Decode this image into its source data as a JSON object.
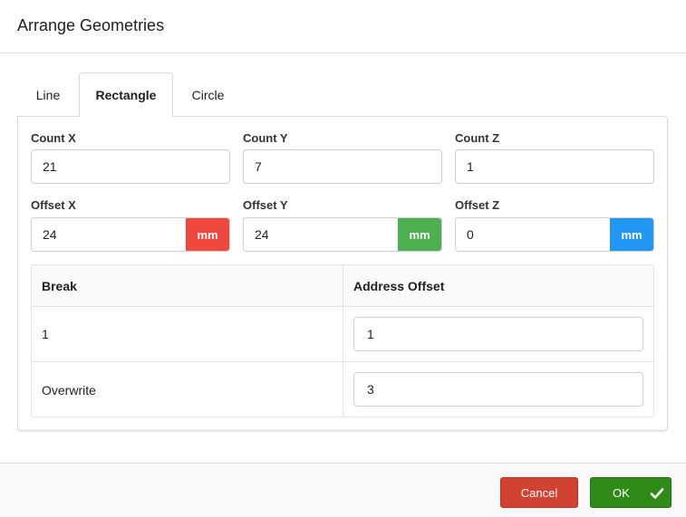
{
  "dialog": {
    "title": "Arrange Geometries"
  },
  "tabs": [
    {
      "label": "Line",
      "active": false
    },
    {
      "label": "Rectangle",
      "active": true
    },
    {
      "label": "Circle",
      "active": false
    }
  ],
  "fields": {
    "count_x": {
      "label": "Count X",
      "value": "21"
    },
    "count_y": {
      "label": "Count Y",
      "value": "7"
    },
    "count_z": {
      "label": "Count Z",
      "value": "1"
    },
    "offset_x": {
      "label": "Offset X",
      "value": "24",
      "unit": "mm",
      "unit_color": "#f0483e"
    },
    "offset_y": {
      "label": "Offset Y",
      "value": "24",
      "unit": "mm",
      "unit_color": "#4caf50"
    },
    "offset_z": {
      "label": "Offset Z",
      "value": "0",
      "unit": "mm",
      "unit_color": "#2196f3"
    }
  },
  "table": {
    "headers": [
      "Break",
      "Address Offset"
    ],
    "rows": [
      {
        "break": "1",
        "address_offset": "1"
      },
      {
        "break": "Overwrite",
        "address_offset": "3"
      }
    ]
  },
  "footer": {
    "cancel_label": "Cancel",
    "ok_label": "OK",
    "cancel_color": "#d24233",
    "ok_color": "#2e8b17",
    "ok_icon": "check-icon"
  }
}
